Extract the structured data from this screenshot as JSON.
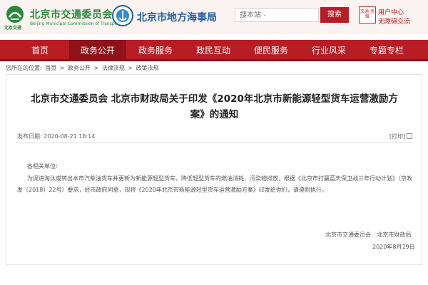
{
  "header": {
    "logo1_title": "北京市交通委员会",
    "logo1_subtitle": "Beijing Municipal Commission of Transport",
    "logo1_mark": "北京交通",
    "logo2_title": "北京市地方海事局",
    "search_placeholder": "搜本站 -",
    "search_label": "搜索",
    "badge_text": "交通 传媒",
    "user_center": "用户中心",
    "accessible": "无障碍交流",
    "colors": {
      "brand_red": "#b81d25",
      "green": "#2a8a3a",
      "blue": "#1f5fa8"
    }
  },
  "nav": {
    "items": [
      "首页",
      "政务公开",
      "政务服务",
      "政民互动",
      "便民服务",
      "行业风采",
      "专题专栏"
    ],
    "active": "政务公开"
  },
  "breadcrumb": {
    "prefix": "您所在的位置:",
    "items": [
      "首页",
      "政务公开",
      "法律法规",
      "政策法规"
    ]
  },
  "article": {
    "title": "北京市交通委员会 北京市财政局关于印发《2020年北京市新能源轻型货车运营激励方案》的通知",
    "date_label": "发布日期:",
    "date": "2020-08-21 18:14",
    "print": "[打印]",
    "greeting": "各相关单位:",
    "body": "为促进淘汰或转出本市汽柴油货车并更新为新能源轻型货车，降低轻型货车的燃油消耗、污染物排放，根据《北京市打赢蓝天保卫战三年行动计划》（京政发〔2018〕22号）要求，经市政府同意，现将《2020年北京市新能源轻型货车运营激励方案》印发给你们，请遵照执行。",
    "signers": "北京市交通委员会 北京市财政局",
    "sign_date": "2020年8月19日"
  }
}
